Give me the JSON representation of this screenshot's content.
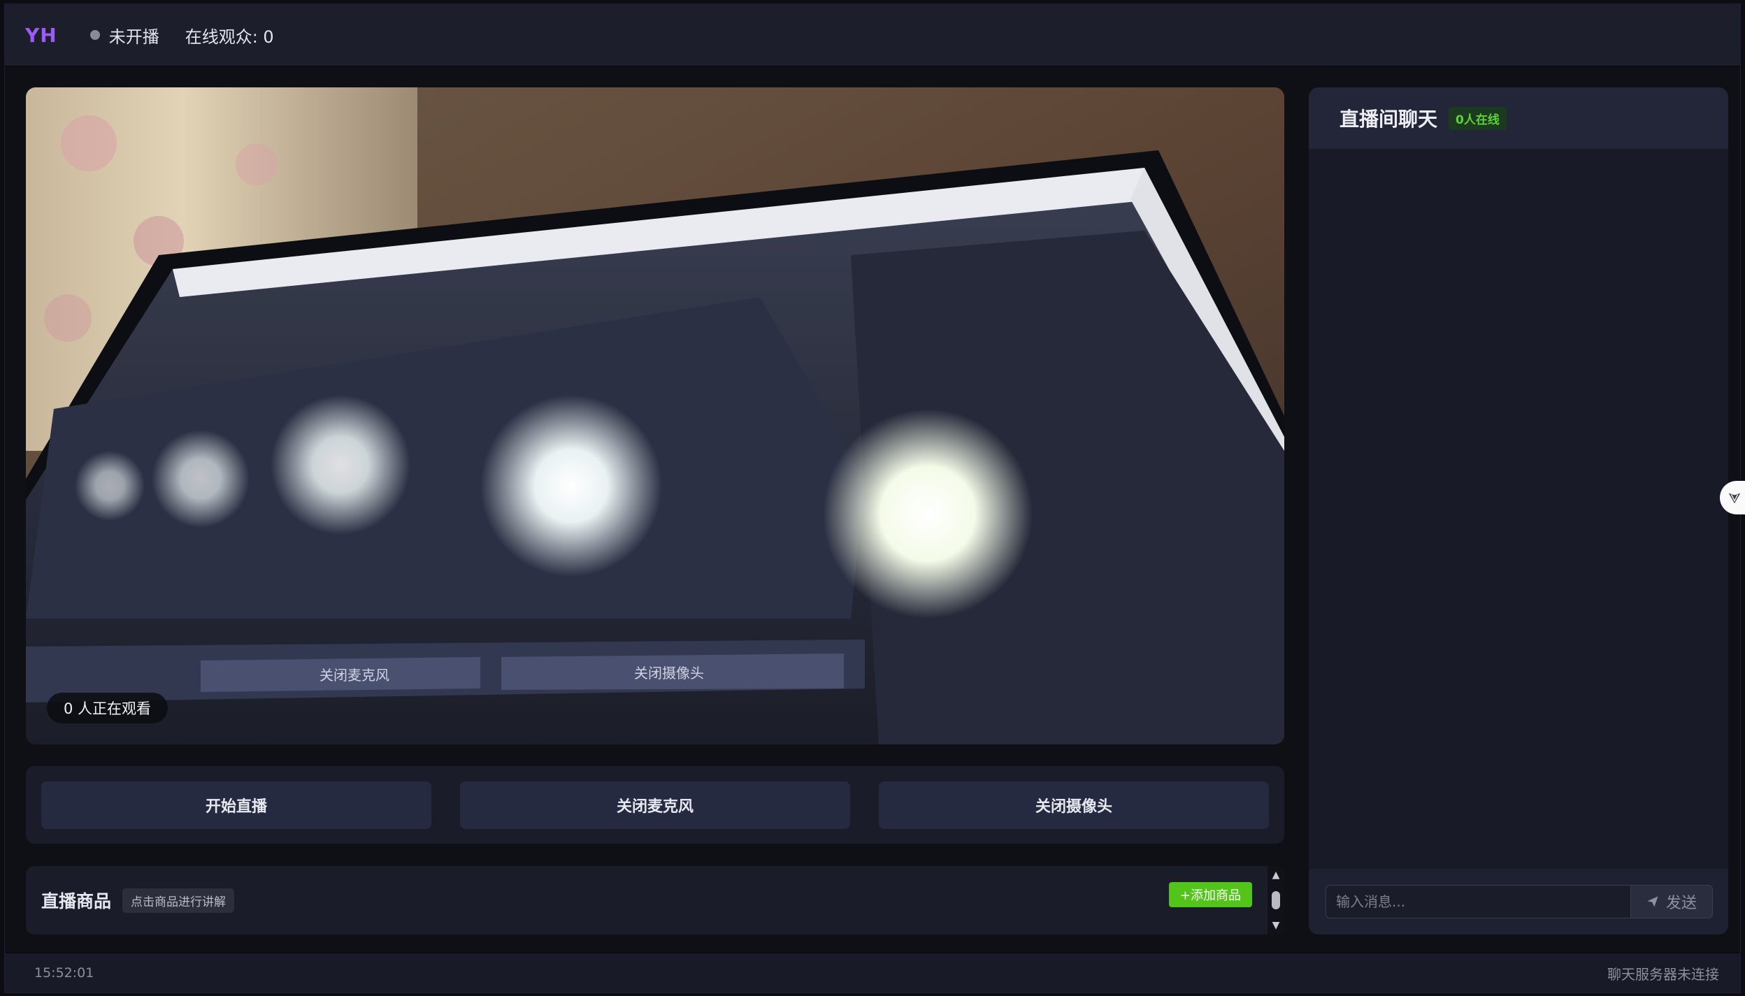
{
  "header": {
    "logo": "YH",
    "stream_status": "未开播",
    "online_viewers": "在线观众: 0"
  },
  "video": {
    "watching_badge": "0 人正在观看"
  },
  "controls": {
    "start_live": "开始直播",
    "mute_mic": "关闭麦克风",
    "close_camera": "关闭摄像头"
  },
  "products": {
    "title": "直播商品",
    "hint": "点击商品进行讲解",
    "add_button": "+添加商品"
  },
  "chat": {
    "title": "直播间聊天",
    "online_badge": "0人在线",
    "input_placeholder": "输入消息...",
    "send_label": "发送",
    "messages": []
  },
  "footer": {
    "time": "15:52:01",
    "server_status": "聊天服务器未连接"
  },
  "colors": {
    "brand": "#9b5cf5",
    "accent_green": "#52c41a",
    "background": "#0f1016",
    "panel": "#1a1c29"
  },
  "icons": {
    "send": "send-icon",
    "status": "status-dot-icon",
    "handle": "chevron-down-icon"
  }
}
